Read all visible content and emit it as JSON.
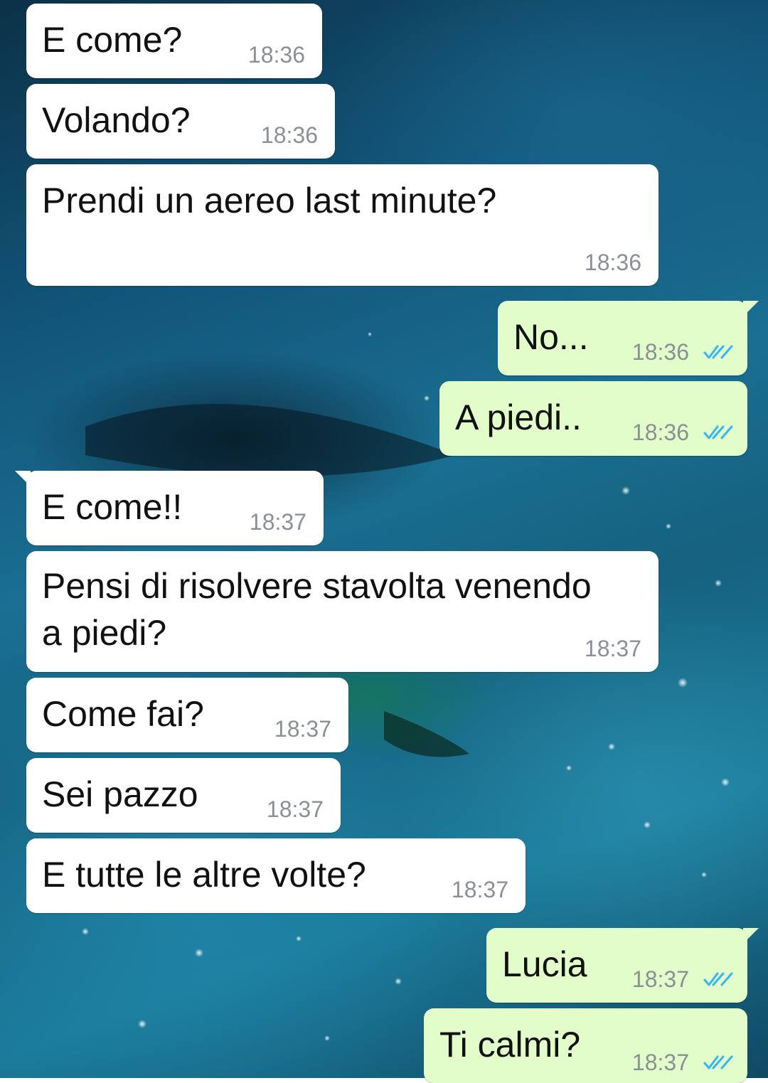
{
  "chat": {
    "messages": [
      {
        "direction": "incoming",
        "text": "E come?",
        "time": "18:36"
      },
      {
        "direction": "incoming",
        "text": "Volando?",
        "time": "18:36"
      },
      {
        "direction": "incoming",
        "text": "Prendi un aereo last minute?",
        "time": "18:36"
      },
      {
        "direction": "outgoing",
        "text": "No...",
        "time": "18:36",
        "status": "read"
      },
      {
        "direction": "outgoing",
        "text": "A piedi..",
        "time": "18:36",
        "status": "read"
      },
      {
        "direction": "incoming",
        "text": "E come!!",
        "time": "18:37"
      },
      {
        "direction": "incoming",
        "text": "Pensi di risolvere stavolta venendo\na piedi?",
        "time": "18:37"
      },
      {
        "direction": "incoming",
        "text": "Come fai?",
        "time": "18:37"
      },
      {
        "direction": "incoming",
        "text": "Sei pazzo",
        "time": "18:37"
      },
      {
        "direction": "incoming",
        "text": "E tutte le altre volte?",
        "time": "18:37"
      },
      {
        "direction": "outgoing",
        "text": "Lucia",
        "time": "18:37",
        "status": "read"
      },
      {
        "direction": "outgoing",
        "text": "Ti calmi?",
        "time": "18:37",
        "status": "read"
      }
    ]
  },
  "colors": {
    "incoming_bubble": "#ffffff",
    "outgoing_bubble": "#e2fdc9",
    "read_ticks": "#34b7f1",
    "timestamp": "#8a9095"
  },
  "icons": {
    "read_status": "double-check-icon"
  }
}
